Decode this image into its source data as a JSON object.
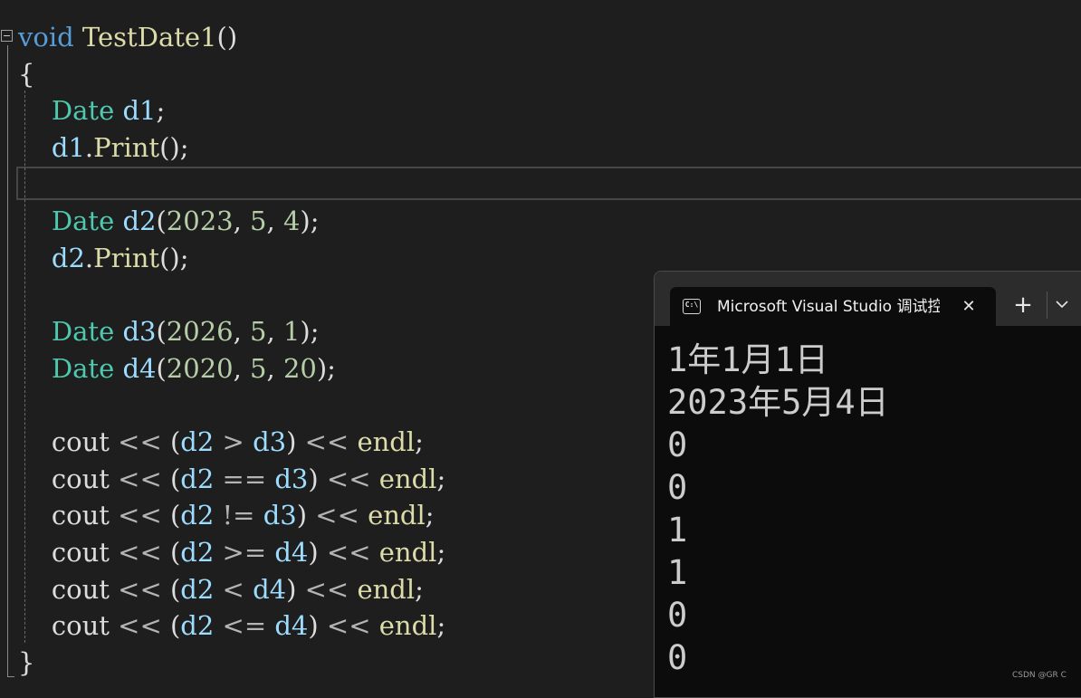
{
  "editor": {
    "lines": [
      [
        {
          "t": "void",
          "c": "kw"
        },
        {
          "t": " ",
          "c": "punc"
        },
        {
          "t": "TestDate1",
          "c": "fn"
        },
        {
          "t": "()",
          "c": "punc"
        }
      ],
      [
        {
          "t": "{",
          "c": "punc"
        }
      ],
      [
        {
          "t": "    ",
          "c": "punc"
        },
        {
          "t": "Date",
          "c": "type"
        },
        {
          "t": " ",
          "c": "punc"
        },
        {
          "t": "d1",
          "c": "var"
        },
        {
          "t": ";",
          "c": "punc"
        }
      ],
      [
        {
          "t": "    ",
          "c": "punc"
        },
        {
          "t": "d1",
          "c": "var"
        },
        {
          "t": ".",
          "c": "punc"
        },
        {
          "t": "Print",
          "c": "fn"
        },
        {
          "t": "();",
          "c": "punc"
        }
      ],
      [],
      [
        {
          "t": "    ",
          "c": "punc"
        },
        {
          "t": "Date",
          "c": "type"
        },
        {
          "t": " ",
          "c": "punc"
        },
        {
          "t": "d2",
          "c": "var"
        },
        {
          "t": "(",
          "c": "punc"
        },
        {
          "t": "2023",
          "c": "num"
        },
        {
          "t": ", ",
          "c": "punc"
        },
        {
          "t": "5",
          "c": "num"
        },
        {
          "t": ", ",
          "c": "punc"
        },
        {
          "t": "4",
          "c": "num"
        },
        {
          "t": ");",
          "c": "punc"
        }
      ],
      [
        {
          "t": "    ",
          "c": "punc"
        },
        {
          "t": "d2",
          "c": "var"
        },
        {
          "t": ".",
          "c": "punc"
        },
        {
          "t": "Print",
          "c": "fn"
        },
        {
          "t": "();",
          "c": "punc"
        }
      ],
      [],
      [
        {
          "t": "    ",
          "c": "punc"
        },
        {
          "t": "Date",
          "c": "type"
        },
        {
          "t": " ",
          "c": "punc"
        },
        {
          "t": "d3",
          "c": "var"
        },
        {
          "t": "(",
          "c": "punc"
        },
        {
          "t": "2026",
          "c": "num"
        },
        {
          "t": ", ",
          "c": "punc"
        },
        {
          "t": "5",
          "c": "num"
        },
        {
          "t": ", ",
          "c": "punc"
        },
        {
          "t": "1",
          "c": "num"
        },
        {
          "t": ");",
          "c": "punc"
        }
      ],
      [
        {
          "t": "    ",
          "c": "punc"
        },
        {
          "t": "Date",
          "c": "type"
        },
        {
          "t": " ",
          "c": "punc"
        },
        {
          "t": "d4",
          "c": "var"
        },
        {
          "t": "(",
          "c": "punc"
        },
        {
          "t": "2020",
          "c": "num"
        },
        {
          "t": ", ",
          "c": "punc"
        },
        {
          "t": "5",
          "c": "num"
        },
        {
          "t": ", ",
          "c": "punc"
        },
        {
          "t": "20",
          "c": "num"
        },
        {
          "t": ");",
          "c": "punc"
        }
      ],
      [],
      [
        {
          "t": "    ",
          "c": "punc"
        },
        {
          "t": "cout",
          "c": "punc"
        },
        {
          "t": " << ",
          "c": "op"
        },
        {
          "t": "(",
          "c": "punc"
        },
        {
          "t": "d2",
          "c": "var"
        },
        {
          "t": " > ",
          "c": "op"
        },
        {
          "t": "d3",
          "c": "var"
        },
        {
          "t": ")",
          "c": "punc"
        },
        {
          "t": " << ",
          "c": "op"
        },
        {
          "t": "endl",
          "c": "fn"
        },
        {
          "t": ";",
          "c": "punc"
        }
      ],
      [
        {
          "t": "    ",
          "c": "punc"
        },
        {
          "t": "cout",
          "c": "punc"
        },
        {
          "t": " << ",
          "c": "op"
        },
        {
          "t": "(",
          "c": "punc"
        },
        {
          "t": "d2",
          "c": "var"
        },
        {
          "t": " == ",
          "c": "op"
        },
        {
          "t": "d3",
          "c": "var"
        },
        {
          "t": ")",
          "c": "punc"
        },
        {
          "t": " << ",
          "c": "op"
        },
        {
          "t": "endl",
          "c": "fn"
        },
        {
          "t": ";",
          "c": "punc"
        }
      ],
      [
        {
          "t": "    ",
          "c": "punc"
        },
        {
          "t": "cout",
          "c": "punc"
        },
        {
          "t": " << ",
          "c": "op"
        },
        {
          "t": "(",
          "c": "punc"
        },
        {
          "t": "d2",
          "c": "var"
        },
        {
          "t": " != ",
          "c": "op"
        },
        {
          "t": "d3",
          "c": "var"
        },
        {
          "t": ")",
          "c": "punc"
        },
        {
          "t": " << ",
          "c": "op"
        },
        {
          "t": "endl",
          "c": "fn"
        },
        {
          "t": ";",
          "c": "punc"
        }
      ],
      [
        {
          "t": "    ",
          "c": "punc"
        },
        {
          "t": "cout",
          "c": "punc"
        },
        {
          "t": " << ",
          "c": "op"
        },
        {
          "t": "(",
          "c": "punc"
        },
        {
          "t": "d2",
          "c": "var"
        },
        {
          "t": " >= ",
          "c": "op"
        },
        {
          "t": "d4",
          "c": "var"
        },
        {
          "t": ")",
          "c": "punc"
        },
        {
          "t": " << ",
          "c": "op"
        },
        {
          "t": "endl",
          "c": "fn"
        },
        {
          "t": ";",
          "c": "punc"
        }
      ],
      [
        {
          "t": "    ",
          "c": "punc"
        },
        {
          "t": "cout",
          "c": "punc"
        },
        {
          "t": " << ",
          "c": "op"
        },
        {
          "t": "(",
          "c": "punc"
        },
        {
          "t": "d2",
          "c": "var"
        },
        {
          "t": " < ",
          "c": "op"
        },
        {
          "t": "d4",
          "c": "var"
        },
        {
          "t": ")",
          "c": "punc"
        },
        {
          "t": " << ",
          "c": "op"
        },
        {
          "t": "endl",
          "c": "fn"
        },
        {
          "t": ";",
          "c": "punc"
        }
      ],
      [
        {
          "t": "    ",
          "c": "punc"
        },
        {
          "t": "cout",
          "c": "punc"
        },
        {
          "t": " << ",
          "c": "op"
        },
        {
          "t": "(",
          "c": "punc"
        },
        {
          "t": "d2",
          "c": "var"
        },
        {
          "t": " <= ",
          "c": "op"
        },
        {
          "t": "d4",
          "c": "var"
        },
        {
          "t": ")",
          "c": "punc"
        },
        {
          "t": " << ",
          "c": "op"
        },
        {
          "t": "endl",
          "c": "fn"
        },
        {
          "t": ";",
          "c": "punc"
        }
      ],
      [
        {
          "t": "}",
          "c": "punc"
        }
      ]
    ],
    "colors": {
      "background": "#1e1e1e",
      "keyword": "#569cd6",
      "function": "#dcdcaa",
      "type": "#4ec9b0",
      "variable": "#9cdcfe",
      "number": "#b5cea8",
      "punctuation": "#dcdcdc",
      "operator": "#b4b4b4"
    },
    "icons": {
      "fold": "collapse-minus-icon"
    }
  },
  "terminal": {
    "tab_title": "Microsoft Visual Studio 调试控制台",
    "tab_icon": "console-icon",
    "tab_icon_text": "C:\\",
    "close_glyph": "✕",
    "new_tab_glyph": "+",
    "dropdown_icon": "chevron-down-icon",
    "output": [
      "1年1月1日",
      "2023年5月4日",
      "0",
      "0",
      "1",
      "1",
      "0",
      "0"
    ],
    "colors": {
      "background": "#0c0c0c",
      "tab_strip": "#2c2c2c",
      "text": "#cccccc"
    }
  },
  "watermark": "CSDN @GR C"
}
